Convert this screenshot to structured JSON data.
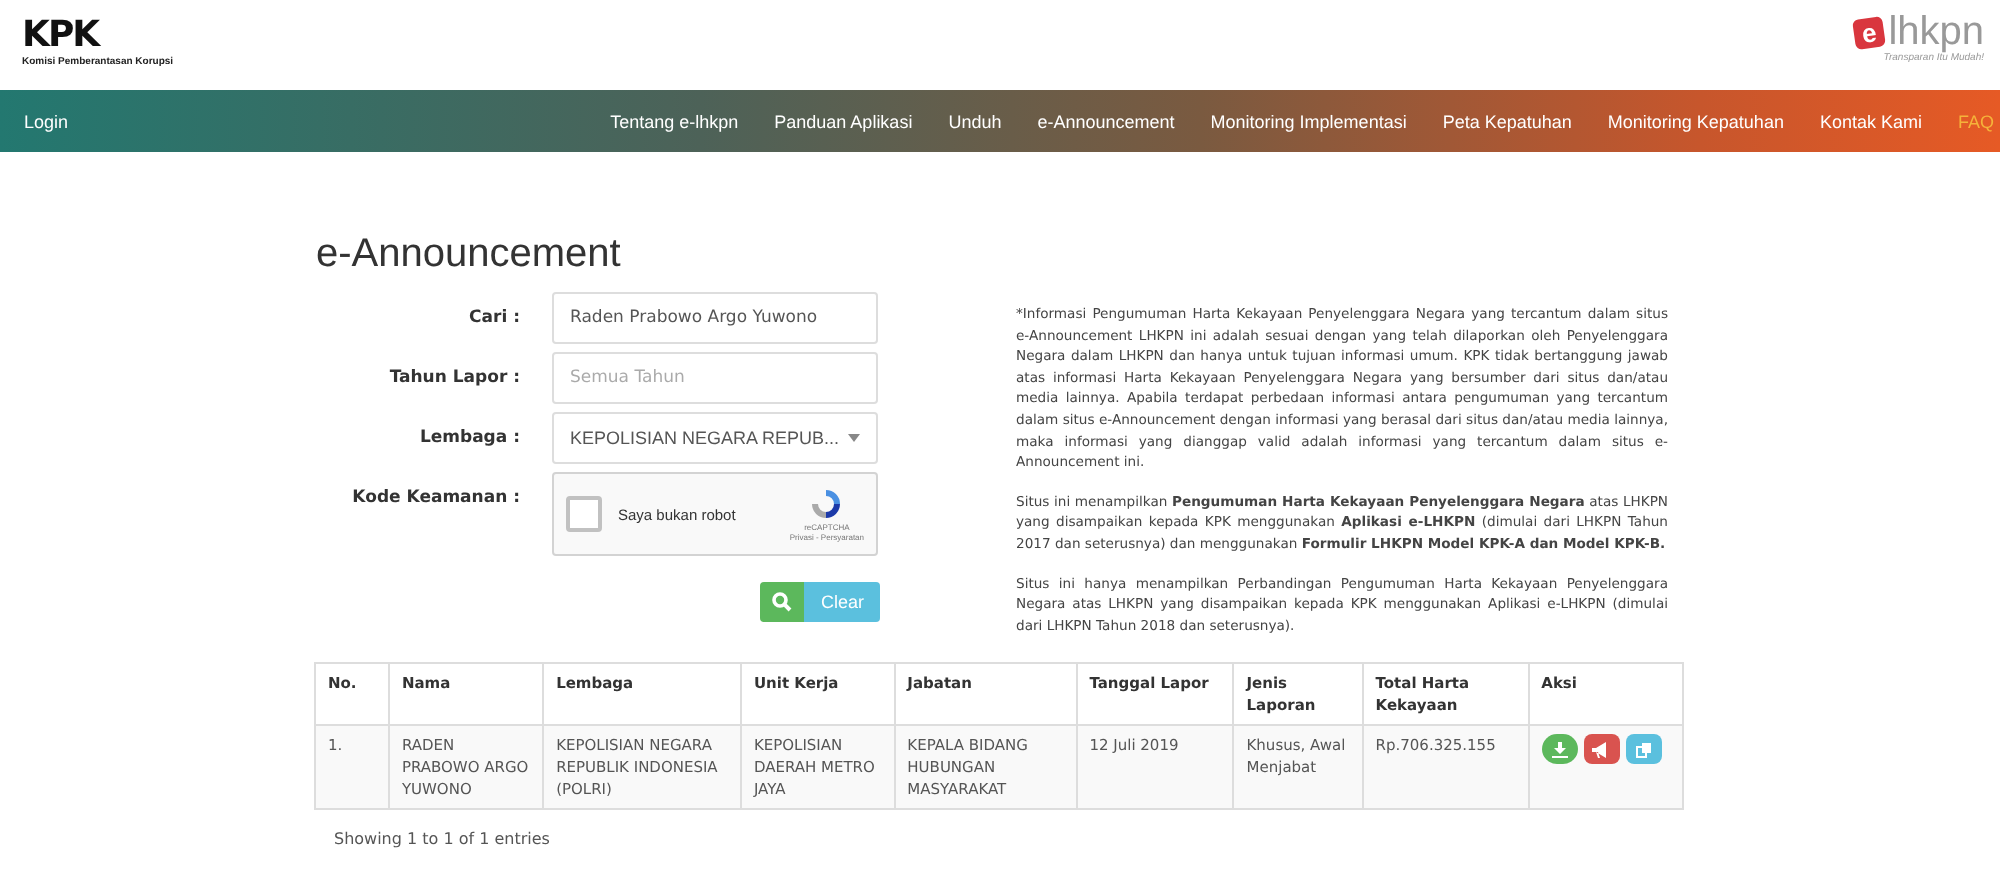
{
  "header": {
    "logo": {
      "text": "KPK",
      "subtitle": "Komisi Pemberantasan Korupsi"
    },
    "brand": {
      "mark": "e",
      "text": "lhkpn",
      "tagline": "Transparan Itu Mudah!"
    }
  },
  "nav": {
    "login": "Login",
    "items": [
      {
        "label": "Tentang e-lhkpn",
        "selected": false
      },
      {
        "label": "Panduan Aplikasi",
        "selected": false
      },
      {
        "label": "Unduh",
        "selected": false
      },
      {
        "label": "e-Announcement",
        "selected": false
      },
      {
        "label": "Monitoring Implementasi",
        "selected": false
      },
      {
        "label": "Peta Kepatuhan",
        "selected": false
      },
      {
        "label": "Monitoring Kepatuhan",
        "selected": false
      },
      {
        "label": "Kontak Kami",
        "selected": false
      },
      {
        "label": "FAQ",
        "selected": true
      }
    ]
  },
  "page_title": "e-Announcement",
  "form": {
    "fields": [
      {
        "kind": "text",
        "label": "Cari :",
        "value": "Raden Prabowo Argo Yuwono"
      },
      {
        "kind": "text",
        "label": "Tahun Lapor :",
        "placeholder": "Semua Tahun"
      },
      {
        "kind": "select",
        "label": "Lembaga :",
        "value": "KEPOLISIAN NEGARA REPUB..."
      },
      {
        "kind": "captcha",
        "label": "Kode Keamanan :",
        "checkbox_label": "Saya bukan robot",
        "checked": false,
        "brand": "reCAPTCHA",
        "links": "Privasi - Persyaratan"
      }
    ],
    "clear_button": "Clear"
  },
  "notes": [
    "*Informasi Pengumuman Harta Kekayaan Penyelenggara Negara yang tercantum dalam situs e-Announcement LHKPN ini adalah sesuai dengan yang telah dilaporkan oleh Penyelenggara Negara dalam LHKPN dan hanya untuk tujuan informasi umum. KPK tidak bertanggung jawab atas informasi Harta Kekayaan Penyelenggara Negara yang bersumber dari situs dan/atau media lainnya. Apabila terdapat perbedaan informasi antara pengumuman yang tercantum dalam situs e-Announcement dengan informasi yang berasal dari situs dan/atau media lainnya, maka informasi yang dianggap valid adalah informasi yang tercantum dalam situs e-Announcement ini.",
    "Situs ini menampilkan **Pengumuman Harta Kekayaan Penyelenggara Negara** atas LHKPN yang disampaikan kepada KPK menggunakan **Aplikasi e-LHKPN** (dimulai dari LHKPN Tahun 2017 dan seterusnya) dan menggunakan **Formulir LHKPN Model KPK-A dan Model KPK-B.**",
    "Situs ini hanya menampilkan Perbandingan Pengumuman Harta Kekayaan Penyelenggara Negara atas LHKPN yang disampaikan kepada KPK menggunakan Aplikasi e-LHKPN (dimulai dari LHKPN Tahun 2018 dan seterusnya)."
  ],
  "table": {
    "columns": [
      "No.",
      "Nama",
      "Lembaga",
      "Unit Kerja",
      "Jabatan",
      "Tanggal Lapor",
      "Jenis Laporan",
      "Total Harta Kekayaan",
      "Aksi"
    ],
    "rows": [
      {
        "cells": [
          "1.",
          "RADEN PRABOWO ARGO YUWONO",
          "KEPOLISIAN NEGARA REPUBLIK INDONESIA (POLRI)",
          "KEPOLISIAN DAERAH METRO JAYA",
          "KEPALA BIDANG HUBUNGAN MASYARAKAT",
          "12 Juli 2019",
          "Khusus, Awal Menjabat",
          "Rp.706.325.155"
        ]
      }
    ]
  },
  "footer_info": "Showing 1 to 1 of 1 entries"
}
